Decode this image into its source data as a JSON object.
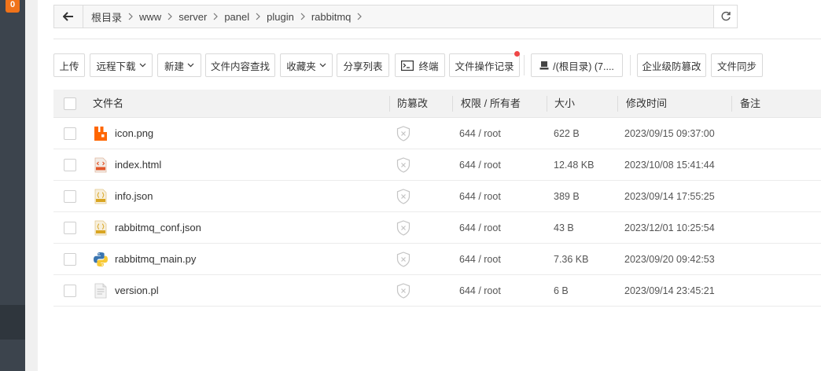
{
  "sidebar": {
    "badge": "0"
  },
  "breadcrumb": [
    "根目录",
    "www",
    "server",
    "panel",
    "plugin",
    "rabbitmq"
  ],
  "toolbar": {
    "upload": "上传",
    "remote_download": "远程下载",
    "new": "新建",
    "content_search": "文件内容查找",
    "favorites": "收藏夹",
    "share_list": "分享列表",
    "terminal": "终端",
    "op_log": "文件操作记录",
    "disk": "/(根目录) (7....",
    "enterprise_tamper": "企业级防篡改",
    "file_sync": "文件同步"
  },
  "columns": {
    "name": "文件名",
    "tamper": "防篡改",
    "perm": "权限 / 所有者",
    "size": "大小",
    "mtime": "修改时间",
    "note": "备注"
  },
  "files": [
    {
      "name": "icon.png",
      "icon": "rabbitmq-image-icon",
      "perm": "644 / root",
      "size": "622 B",
      "mtime": "2023/09/15 09:37:00"
    },
    {
      "name": "index.html",
      "icon": "html-file-icon",
      "perm": "644 / root",
      "size": "12.48 KB",
      "mtime": "2023/10/08 15:41:44"
    },
    {
      "name": "info.json",
      "icon": "json-file-icon",
      "perm": "644 / root",
      "size": "389 B",
      "mtime": "2023/09/14 17:55:25"
    },
    {
      "name": "rabbitmq_conf.json",
      "icon": "json-file-icon",
      "perm": "644 / root",
      "size": "43 B",
      "mtime": "2023/12/01 10:25:54"
    },
    {
      "name": "rabbitmq_main.py",
      "icon": "python-file-icon",
      "perm": "644 / root",
      "size": "7.36 KB",
      "mtime": "2023/09/20 09:42:53"
    },
    {
      "name": "version.pl",
      "icon": "text-file-icon",
      "perm": "644 / root",
      "size": "6 B",
      "mtime": "2023/09/14 23:45:21"
    }
  ],
  "colors": {
    "sidebar": "#3c444d",
    "badge": "#f0731a",
    "rabbit": "#ff6600",
    "reddot": "#ef4646"
  }
}
